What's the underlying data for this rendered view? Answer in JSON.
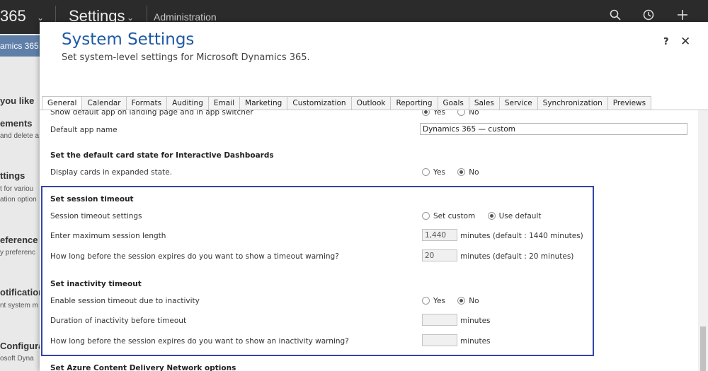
{
  "topnav": {
    "brand": "365",
    "area": "Settings",
    "breadcrumb": "Administration",
    "icons": [
      "chevron-down-icon",
      "search-icon",
      "history-icon",
      "plus-icon"
    ]
  },
  "background": {
    "panel_header": "amics 365",
    "items": [
      {
        "title": "you like",
        "desc": ""
      },
      {
        "title": "ements",
        "desc": "and delete a"
      },
      {
        "title": "ttings",
        "desc": "t for variou"
      },
      {
        "title": "",
        "desc": "ation option"
      },
      {
        "title": "eference",
        "desc": "y preferenc"
      },
      {
        "title": "otification",
        "desc": "nt system m"
      },
      {
        "title": "Configura",
        "desc": "osoft Dyna"
      }
    ]
  },
  "dialog": {
    "title": "System Settings",
    "subtitle": "Set system-level settings for Microsoft Dynamics 365.",
    "help": "?",
    "close": "✕",
    "tabs": [
      "General",
      "Calendar",
      "Formats",
      "Auditing",
      "Email",
      "Marketing",
      "Customization",
      "Outlook",
      "Reporting",
      "Goals",
      "Sales",
      "Service",
      "Synchronization",
      "Previews"
    ],
    "active_tab": "General",
    "content": {
      "landing": {
        "label": "Show default app on landing page and in app switcher",
        "options": [
          "Yes",
          "No"
        ],
        "selected": "Yes"
      },
      "default_app_name": {
        "label": "Default app name",
        "value": "Dynamics 365 — custom"
      },
      "card_section": {
        "heading": "Set the default card state for Interactive Dashboards",
        "label": "Display cards in expanded state.",
        "options": [
          "Yes",
          "No"
        ],
        "selected": "No"
      },
      "session": {
        "heading": "Set session timeout",
        "settings_label": "Session timeout settings",
        "settings_options": [
          "Set custom",
          "Use default"
        ],
        "settings_selected": "Use default",
        "max_label": "Enter maximum session length",
        "max_value": "1,440",
        "max_unit": "minutes  (default : 1440 minutes)",
        "warn_label": "How long before the session expires do you want to show a timeout warning?",
        "warn_value": "20",
        "warn_unit": "minutes  (default : 20 minutes)"
      },
      "inactivity": {
        "heading": "Set inactivity timeout",
        "enable_label": "Enable session timeout due to inactivity",
        "enable_options": [
          "Yes",
          "No"
        ],
        "enable_selected": "No",
        "duration_label": "Duration of inactivity before timeout",
        "duration_value": "",
        "duration_unit": "minutes",
        "warn_label": "How long before the session expires do you want to show an inactivity warning?",
        "warn_value": "",
        "warn_unit": "minutes"
      },
      "cdn_heading": "Set Azure Content Delivery Network options"
    }
  },
  "colors": {
    "title_blue": "#1f5aa6",
    "highlight_border": "#3344aa",
    "topnav_bg": "#2b2b2b",
    "panel_header_bg": "#5f7fa9"
  }
}
